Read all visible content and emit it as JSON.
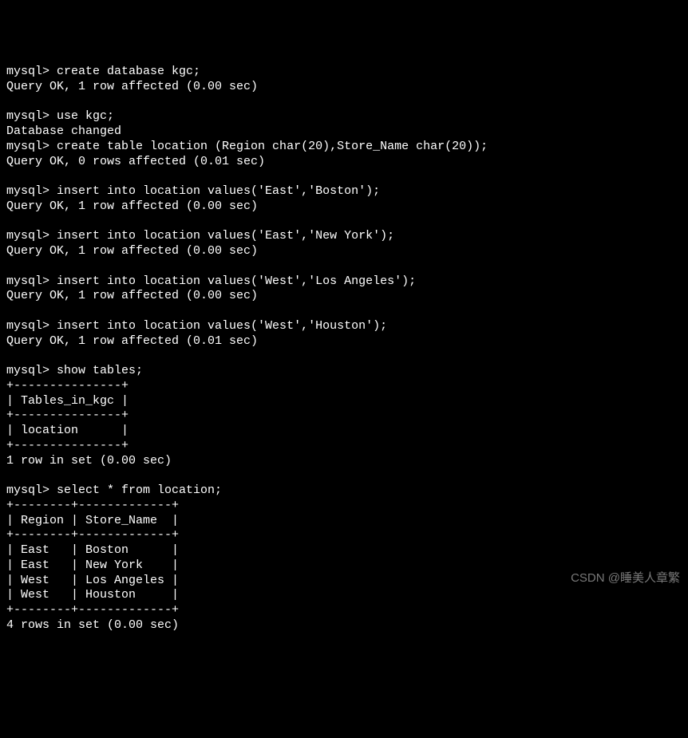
{
  "prompt": "mysql> ",
  "commands": {
    "create_db": "create database kgc;",
    "use_db": "use kgc;",
    "create_table": "create table location (Region char(20),Store_Name char(20));",
    "insert1": "insert into location values('East','Boston');",
    "insert2": "insert into location values('East','New York');",
    "insert3": "insert into location values('West','Los Angeles');",
    "insert4": "insert into location values('West','Houston');",
    "show_tables": "show tables;",
    "select_all": "select * from location;"
  },
  "responses": {
    "ok_1row_000": "Query OK, 1 row affected (0.00 sec)",
    "db_changed": "Database changed",
    "ok_0rows_001": "Query OK, 0 rows affected (0.01 sec)",
    "ok_1row_001": "Query OK, 1 row affected (0.01 sec)",
    "set_1row": "1 row in set (0.00 sec)",
    "set_4rows": "4 rows in set (0.00 sec)"
  },
  "show_tables_result": {
    "sep": "+---------------+",
    "header": "| Tables_in_kgc |",
    "row1": "| location      |"
  },
  "select_result": {
    "sep": "+--------+-------------+",
    "header": "| Region | Store_Name  |",
    "rows": [
      "| East   | Boston      |",
      "| East   | New York    |",
      "| West   | Los Angeles |",
      "| West   | Houston     |"
    ]
  },
  "watermark": "CSDN @睡美人章繁"
}
